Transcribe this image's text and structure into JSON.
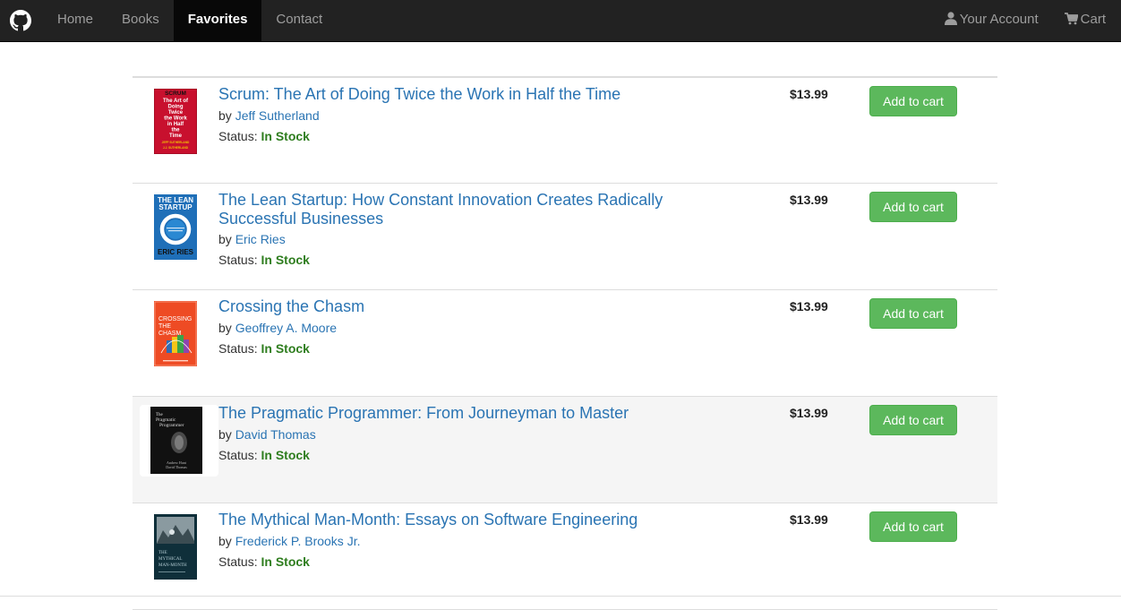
{
  "nav": {
    "brand_icon": "github-icon",
    "links": [
      {
        "label": "Home",
        "active": false
      },
      {
        "label": "Books",
        "active": false
      },
      {
        "label": "Favorites",
        "active": true
      },
      {
        "label": "Contact",
        "active": false
      }
    ],
    "account_label": "Your Account",
    "account_icon": "user-icon",
    "cart_label": "Cart",
    "cart_icon": "shopping-cart-icon"
  },
  "books": [
    {
      "title": "Scrum: The Art of Doing Twice the Work in Half the Time",
      "by": "by",
      "author": "Jeff Sutherland",
      "status_label": "Status:",
      "status": "In Stock",
      "price": "$13.99",
      "button": "Add to cart",
      "cover_text": [
        "SCRUM",
        "The Art of",
        "Doing",
        "Twice",
        "the Work",
        "in Half",
        "the",
        "Time",
        "JEFF SUTHERLAND",
        "J.J. SUTHERLAND"
      ]
    },
    {
      "title": "The Lean Startup: How Constant Innovation Creates Radically Successful Businesses",
      "by": "by",
      "author": "Eric Ries",
      "status_label": "Status:",
      "status": "In Stock",
      "price": "$13.99",
      "button": "Add to cart",
      "cover_text": [
        "THE LEAN",
        "STARTUP",
        "ERIC RIES"
      ]
    },
    {
      "title": "Crossing the Chasm",
      "by": "by",
      "author": "Geoffrey A. Moore",
      "status_label": "Status:",
      "status": "In Stock",
      "price": "$13.99",
      "button": "Add to cart",
      "cover_text": [
        "CROSSING",
        "THE",
        "CHASM"
      ]
    },
    {
      "title": "The Pragmatic Programmer: From Journeyman to Master",
      "by": "by",
      "author": "David Thomas",
      "status_label": "Status:",
      "status": "In Stock",
      "price": "$13.99",
      "button": "Add to cart",
      "cover_text": [
        "The",
        "Pragmatic",
        "Programmer",
        "Andrew Hunt",
        "David Thomas"
      ]
    },
    {
      "title": "The Mythical Man-Month: Essays on Software Engineering",
      "by": "by",
      "author": "Frederick P. Brooks Jr.",
      "status_label": "Status:",
      "status": "In Stock",
      "price": "$13.99",
      "button": "Add to cart",
      "cover_text": [
        "THE",
        "MYTHICAL",
        "MAN-MONTH"
      ]
    }
  ],
  "colors": {
    "navbar_bg": "#222222",
    "link": "#2a74b3",
    "in_stock": "#2e7d1e",
    "button_bg": "#5cb85c"
  }
}
